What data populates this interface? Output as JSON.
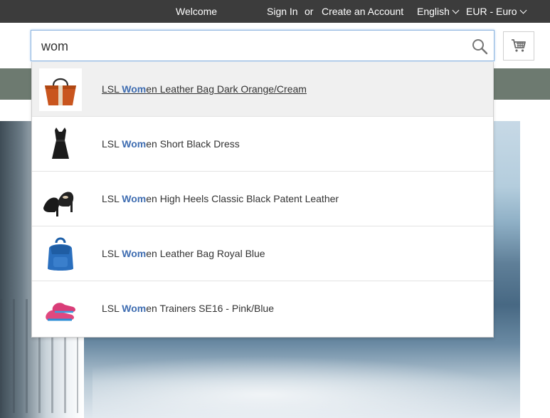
{
  "topbar": {
    "welcome": "Welcome",
    "sign_in": "Sign In",
    "or": "or",
    "create_account": "Create an Account",
    "language": "English",
    "currency": "EUR - Euro"
  },
  "search": {
    "value": "wom",
    "icon": "search-icon"
  },
  "cart": {
    "icon": "shopping-cart-icon"
  },
  "autocomplete": {
    "highlight_color": "#3f6db1",
    "items": [
      {
        "prefix": "LSL ",
        "match": "Wom",
        "suffix": "en Leather Bag Dark Orange/Cream",
        "thumb": "orange-leather-bag",
        "active": true
      },
      {
        "prefix": "LSL ",
        "match": "Wom",
        "suffix": "en Short Black Dress",
        "thumb": "black-dress",
        "active": false
      },
      {
        "prefix": "LSL ",
        "match": "Wom",
        "suffix": "en High Heels Classic Black Patent Leather",
        "thumb": "black-high-heels",
        "active": false
      },
      {
        "prefix": "LSL ",
        "match": "Wom",
        "suffix": "en Leather Bag Royal Blue",
        "thumb": "blue-backpack",
        "active": false
      },
      {
        "prefix": "LSL ",
        "match": "Wom",
        "suffix": "en Trainers SE16 - Pink/Blue",
        "thumb": "pink-trainers",
        "active": false
      }
    ]
  },
  "colors": {
    "topbar_bg": "#3c3c3c",
    "nav_bg": "#6d7a70",
    "search_focus_border": "#8fb6e0"
  }
}
